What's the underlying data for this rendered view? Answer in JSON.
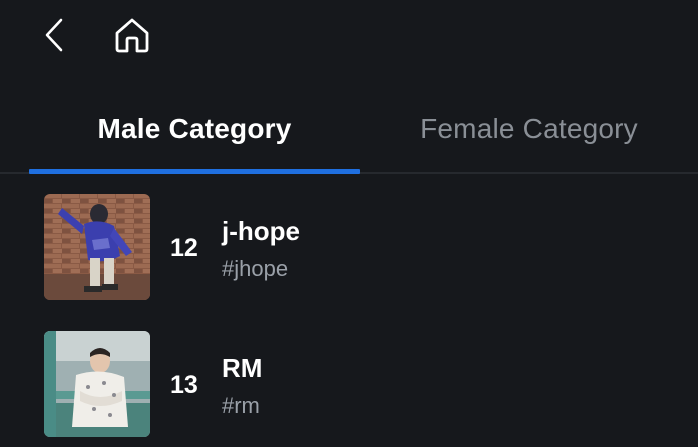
{
  "nav": {
    "back_icon": "chevron-left-icon",
    "home_icon": "home-icon"
  },
  "tabs": [
    {
      "label": "Male Category",
      "selected": true
    },
    {
      "label": "Female Category",
      "selected": false
    }
  ],
  "colors": {
    "background": "#16181c",
    "accent": "#1f6fe0",
    "inactive_tab": "#8a8f96",
    "secondary_text": "#9aa0a8"
  },
  "list": [
    {
      "rank": "12",
      "name": "j-hope",
      "tag": "#jhope"
    },
    {
      "rank": "13",
      "name": "RM",
      "tag": "#rm"
    }
  ]
}
